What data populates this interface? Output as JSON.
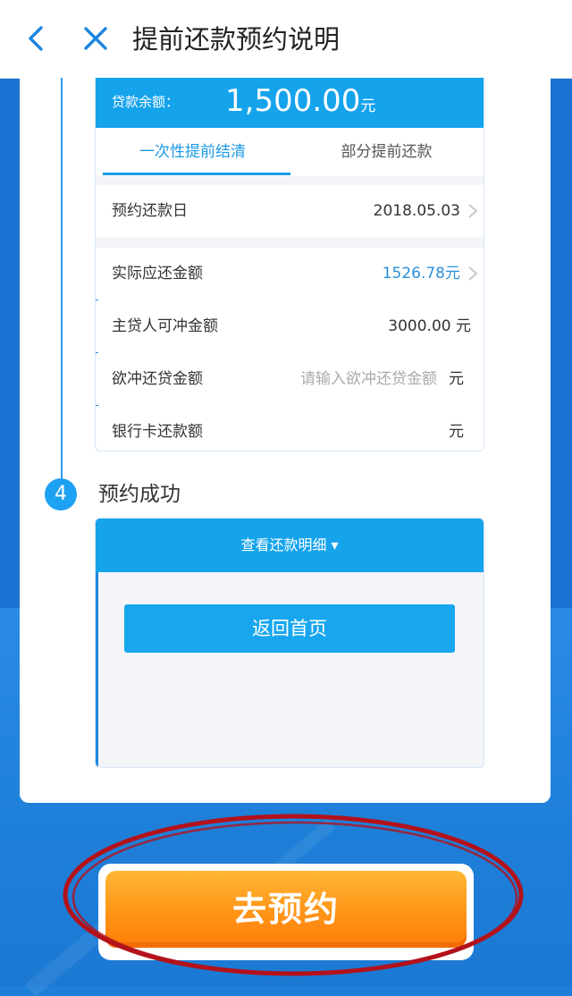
{
  "header": {
    "title": "提前还款预约说明"
  },
  "form_mock": {
    "balance_label": "贷款余额：",
    "balance_value": "1,500.00",
    "balance_unit": "元",
    "tabs": [
      {
        "label": "一次性提前结清",
        "active": true
      },
      {
        "label": "部分提前还款",
        "active": false
      }
    ],
    "rows": [
      {
        "label": "预约还款日",
        "value": "2018.05.03"
      },
      {
        "label": "实际应还金额",
        "value": "1526.78元"
      },
      {
        "label": "主贷人可冲金额",
        "value": "3000.00 元"
      },
      {
        "label": "欲冲还贷金额",
        "placeholder": "请输入欲冲还贷金额",
        "unit": "元"
      },
      {
        "label": "银行卡还款额",
        "unit": "元"
      }
    ]
  },
  "step": {
    "number": "4",
    "label": "预约成功"
  },
  "success_mock": {
    "detail_label": "查看还款明细 ▾",
    "home_button": "返回首页"
  },
  "cta": {
    "label": "去预约"
  },
  "colors": {
    "primary_blue": "#15a3ec",
    "cta_orange": "#ff9417",
    "annotation_red": "#b3121b"
  }
}
